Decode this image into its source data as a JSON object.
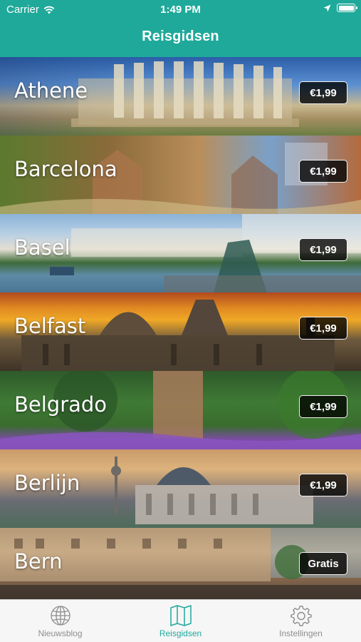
{
  "status_bar": {
    "carrier": "Carrier",
    "time": "1:49 PM"
  },
  "nav": {
    "title": "Reisgidsen"
  },
  "cities": [
    {
      "name": "Athene",
      "price": "€1,99"
    },
    {
      "name": "Barcelona",
      "price": "€1,99"
    },
    {
      "name": "Basel",
      "price": "€1,99"
    },
    {
      "name": "Belfast",
      "price": "€1,99"
    },
    {
      "name": "Belgrado",
      "price": "€1,99"
    },
    {
      "name": "Berlijn",
      "price": "€1,99"
    },
    {
      "name": "Bern",
      "price": "Gratis"
    }
  ],
  "tabbar": {
    "items": [
      {
        "label": "Nieuwsblog",
        "icon": "globe-icon",
        "active": false
      },
      {
        "label": "Reisgidsen",
        "icon": "map-icon",
        "active": true
      },
      {
        "label": "Instellingen",
        "icon": "gear-icon",
        "active": false
      }
    ]
  },
  "colors": {
    "accent": "#1fa99a",
    "tab_inactive": "#8e8e8e"
  }
}
